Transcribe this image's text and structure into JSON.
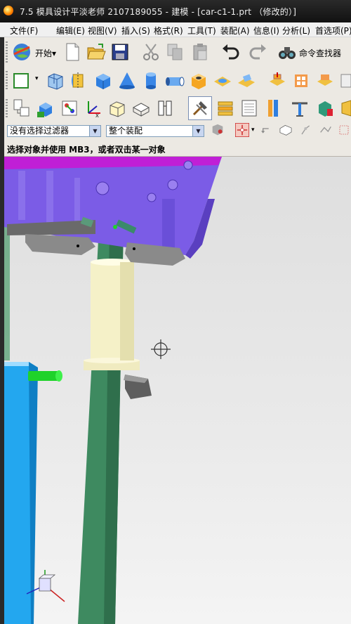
{
  "window": {
    "title": "7.5  模具设计平淡老师   2107189055 - 建模 - [car-c1-1.prt （修改的）]"
  },
  "menu": [
    {
      "label": "文件(F)"
    },
    {
      "label": "编辑(E)"
    },
    {
      "label": "视图(V)"
    },
    {
      "label": "插入(S)"
    },
    {
      "label": "格式(R)"
    },
    {
      "label": "工具(T)"
    },
    {
      "label": "装配(A)"
    },
    {
      "label": "信息(I)"
    },
    {
      "label": "分析(L)"
    },
    {
      "label": "首选项(P)"
    }
  ],
  "toolbar": {
    "start_label": "开始",
    "start_menu_arrow": "▾",
    "command_finder_label": "命令查找器"
  },
  "selection_bar": {
    "filter_value": "没有选择过滤器",
    "scope_value": "整个装配"
  },
  "status": {
    "message": "选择对象并使用 MB3，或者双击某一对象"
  },
  "icons": {
    "app": "nx-logo-icon",
    "start": "globe-start-icon",
    "crosshair": "cursor-crosshair-icon",
    "triad": "wcs-triad-icon"
  },
  "colors": {
    "titlebar": "#1c1c1c",
    "toolbar": "#ece9e3",
    "mold_plate": "#7b5ce6",
    "mold_plate_top": "#c01fd6",
    "guide_pillar": "#3e8a60",
    "bushing": "#f5f1c8",
    "ejector": "#23a7ef",
    "green_pin": "#1fd22a",
    "background_top": "#dedede"
  }
}
